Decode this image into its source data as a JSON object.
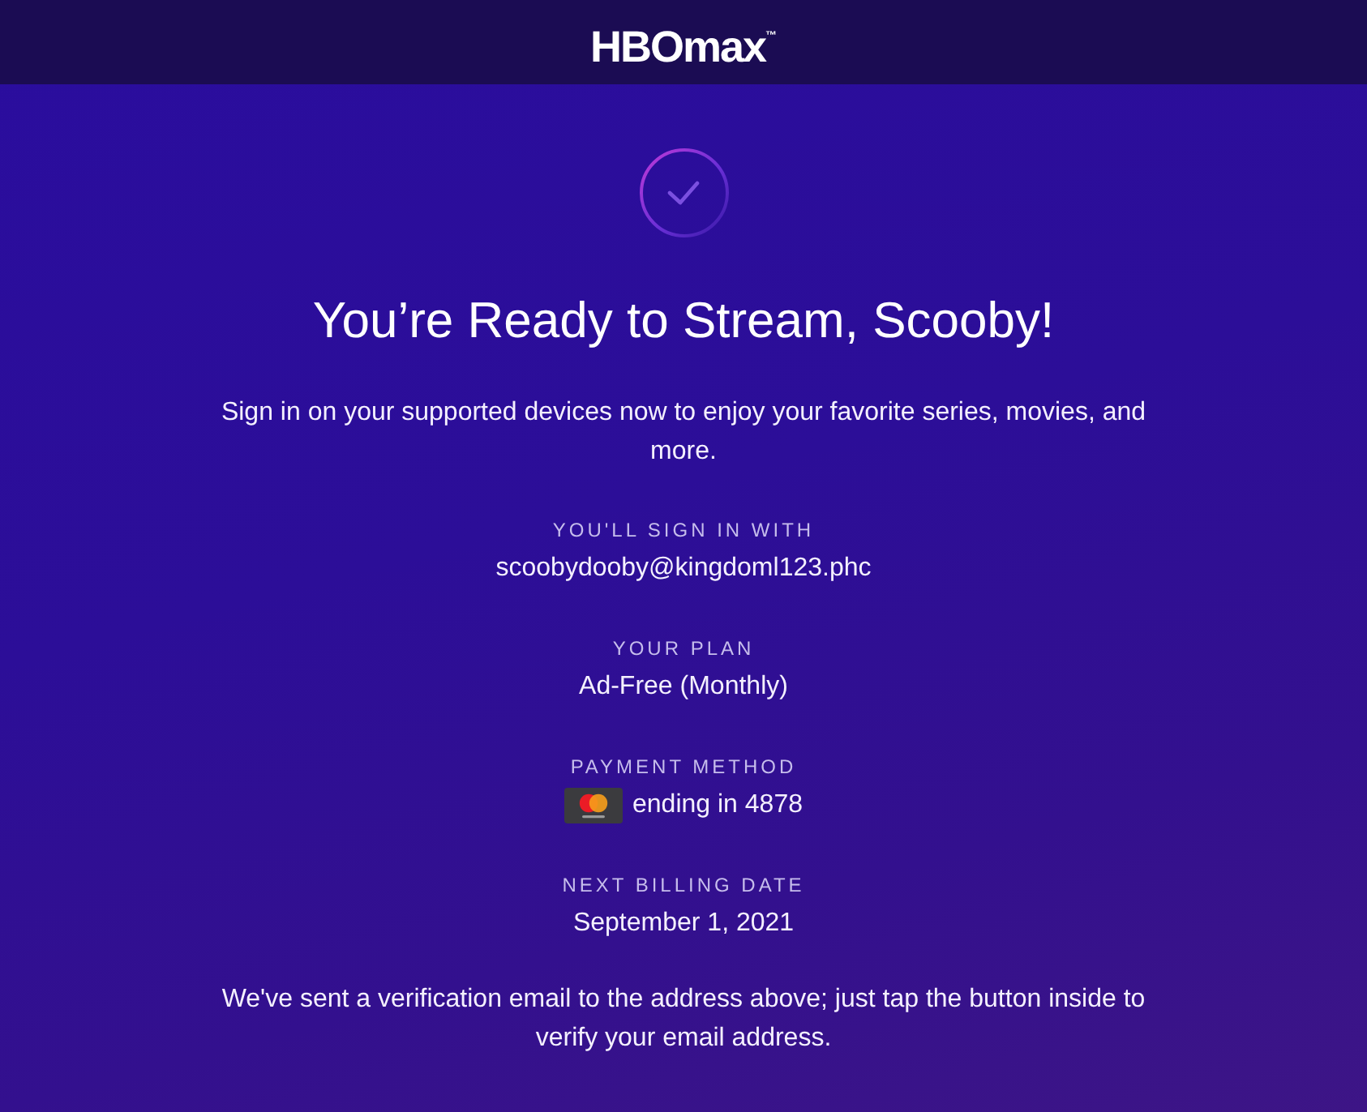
{
  "header": {
    "logo": "HBOmax$^{™}$"
  },
  "title": "You’re Ready to Stream, Scooby!",
  "intro": "Sign in on your supported devices now to enjoy your favorite series, movies, and more.",
  "details": [
    {
      "kind": "text",
      "label": "YOU'LL SIGN IN WITH",
      "value": "scoobydooby@kingdoml123.phc"
    },
    {
      "kind": "text",
      "label": "YOUR PLAN",
      "value": "Ad-Free (Monthly)"
    },
    {
      "kind": "card",
      "label": "PAYMENT METHOD",
      "value": "ending in 4878"
    },
    {
      "kind": "text",
      "label": "NEXT BILLING DATE",
      "value": "September 1, 2021"
    }
  ],
  "note": "We've sent a verification email to the address above; just tap the button inside to verify your email address."
}
